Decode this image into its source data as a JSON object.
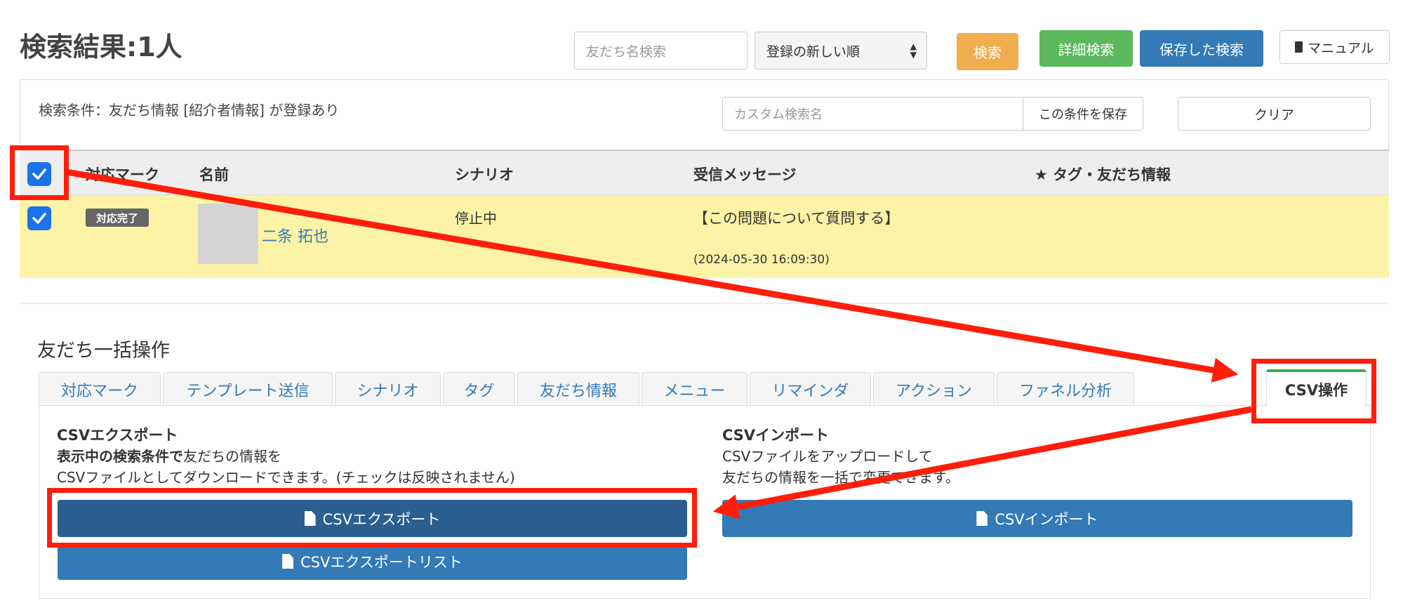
{
  "page": {
    "title": "検索結果:1人"
  },
  "toolbar": {
    "search_placeholder": "友だち名検索",
    "sort_selected": "登録の新しい順",
    "search_label": "検索",
    "advanced_label": "詳細検索",
    "saved_label": "保存した検索",
    "manual_label": "マニュアル"
  },
  "filter": {
    "condition_text": "検索条件：友だち情報 [紹介者情報] が登録あり",
    "custom_name_placeholder": "カスタム検索名",
    "save_label": "この条件を保存",
    "clear_label": "クリア"
  },
  "table": {
    "columns": [
      "対応マーク",
      "名前",
      "シナリオ",
      "受信メッセージ",
      "★ タグ・友だち情報"
    ],
    "rows": [
      {
        "badge": "対応完了",
        "name": "二条 拓也",
        "scenario": "停止中",
        "message": "【この問題について質問する】",
        "timestamp": "(2024-05-30 16:09:30)"
      }
    ]
  },
  "bulk": {
    "title": "友だち一括操作",
    "tabs": [
      "対応マーク",
      "テンプレート送信",
      "シナリオ",
      "タグ",
      "友だち情報",
      "メニュー",
      "リマインダ",
      "アクション",
      "ファネル分析",
      "CSV操作"
    ],
    "export": {
      "title": "CSVエクスポート",
      "desc_bold": "表示中の検索条件で",
      "desc_rest": "友だちの情報を",
      "desc_line2": "CSVファイルとしてダウンロードできます。(チェックは反映されません)",
      "button": "CSVエクスポート",
      "list_button": "CSVエクスポートリスト"
    },
    "import": {
      "title": "CSVインポート",
      "desc_line1": "CSVファイルをアップロードして",
      "desc_line2": "友だちの情報を一括で変更できます。",
      "button": "CSVインポート"
    }
  },
  "colors": {
    "annotation_red": "#ff1e0a",
    "primary_blue": "#337ab7",
    "dark_blue": "#2a5f8f",
    "success_green": "#5cb85c",
    "warning_orange": "#f0ad4e",
    "row_highlight": "#fdf3a6"
  }
}
